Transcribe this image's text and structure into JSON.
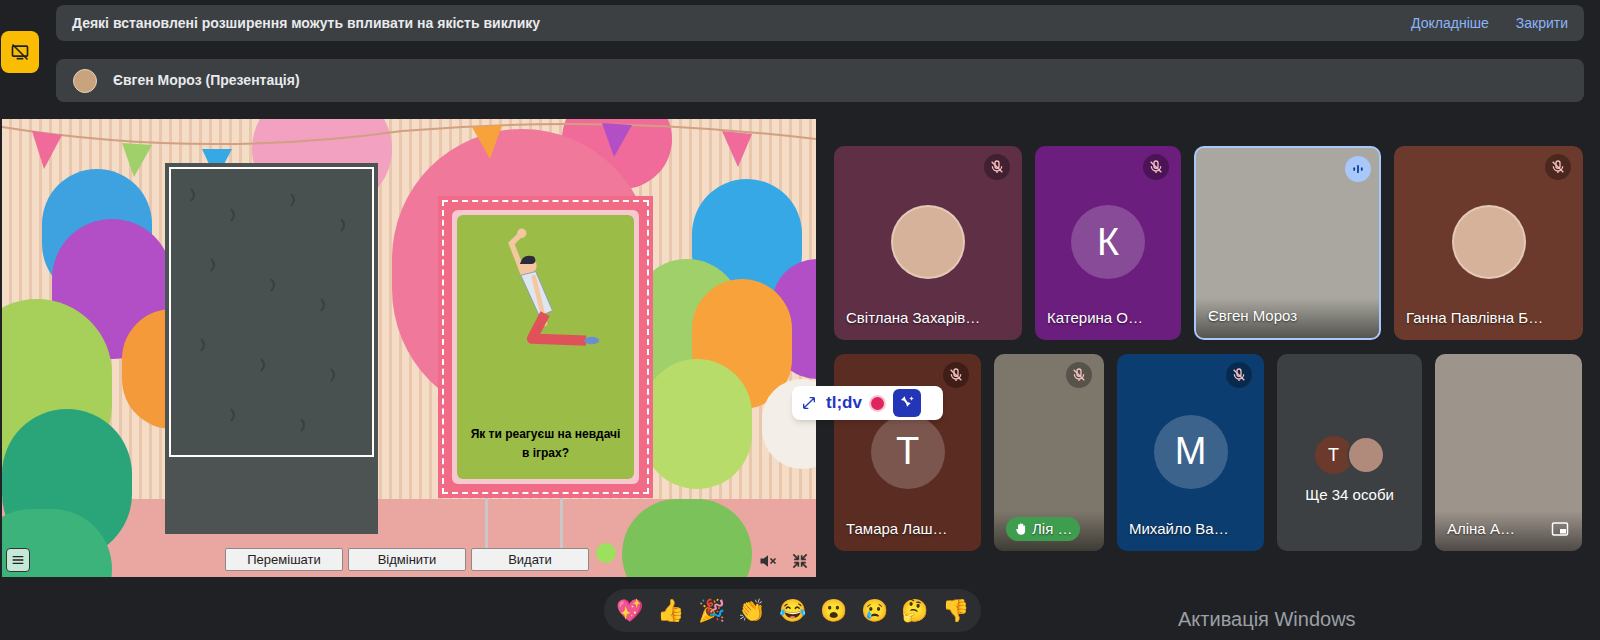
{
  "notification": {
    "text": "Деякі встановлені розширення можуть впливати на якість виклику",
    "links": [
      "Докладніше",
      "Закрити"
    ]
  },
  "presenter_bar": {
    "label": "Євген Мороз (Презентація)"
  },
  "presentation": {
    "card": {
      "question": "Як ти реагуєш на невдачі в іграх?"
    },
    "buttons": [
      "Перемішати",
      "Відмінити",
      "Видати"
    ],
    "sound_muted": true
  },
  "tiles": [
    {
      "name": "Світлана Захарів…",
      "kind": "photo",
      "muted": true,
      "speaking": false,
      "hand_raised": false,
      "self": false,
      "color": "#5e2f45"
    },
    {
      "name": "Катерина О…",
      "kind": "initial",
      "initial": "К",
      "muted": true,
      "speaking": false,
      "hand_raised": false,
      "self": false,
      "color": "#6b1e7d"
    },
    {
      "name": "Євген Мороз",
      "kind": "video",
      "muted": false,
      "speaking": true,
      "hand_raised": false,
      "self": false,
      "color": "#a9a79f"
    },
    {
      "name": "Ганна Павлівна Б…",
      "kind": "photo",
      "muted": true,
      "speaking": false,
      "hand_raised": false,
      "self": false,
      "color": "#6b3a2c"
    },
    {
      "name": "Тамара Лаш…",
      "kind": "initial",
      "initial": "Т",
      "muted": true,
      "speaking": false,
      "hand_raised": false,
      "self": false,
      "color": "#5a2c22"
    },
    {
      "name": "Лія …",
      "kind": "video",
      "muted": true,
      "speaking": false,
      "hand_raised": true,
      "self": false,
      "color": "#7d776b"
    },
    {
      "name": "Михайло Ва…",
      "kind": "initial",
      "initial": "М",
      "muted": true,
      "speaking": false,
      "hand_raised": false,
      "self": false,
      "color": "#0c3d70"
    },
    {
      "name": "Ще 34 особи",
      "kind": "overflow",
      "initial": "Т",
      "muted": false,
      "speaking": false,
      "hand_raised": false,
      "self": false,
      "color": "#3c4043"
    },
    {
      "name": "Аліна А…",
      "kind": "video",
      "muted": false,
      "speaking": false,
      "hand_raised": false,
      "self": true,
      "color": "#9d948c"
    }
  ],
  "recorder": {
    "label": "tl;dv",
    "recording": true
  },
  "reactions": [
    "💖",
    "👍",
    "🎉",
    "👏",
    "😂",
    "😮",
    "😢",
    "🤔",
    "👎"
  ],
  "watermark": "Активація Windows"
}
